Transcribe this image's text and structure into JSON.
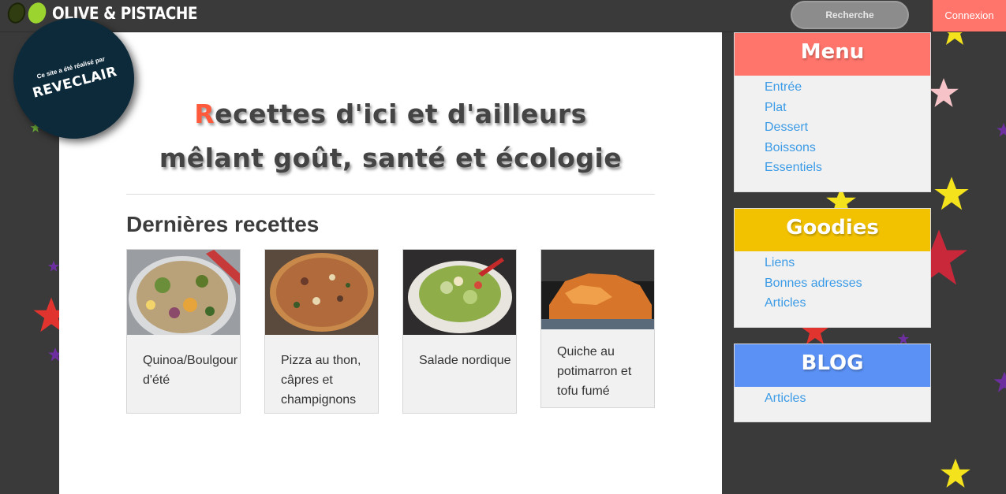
{
  "header": {
    "logo_text": "OLIVE & PISTACHE",
    "search_placeholder": "Recherche",
    "login_label": "Connexion"
  },
  "badge": {
    "line1": "Ce site a été réalisé par",
    "line2": "REVECLAIR"
  },
  "hero": {
    "first_letter": "R",
    "line1_rest": "ecettes d'ici et d'ailleurs",
    "line2": "mêlant goût, santé et écologie"
  },
  "latest": {
    "title": "Dernières recettes",
    "recipes": [
      {
        "title": "Quinoa/Boulgour d'été",
        "image": "quinoa-salad-photo"
      },
      {
        "title": "Pizza au thon, câpres et champignons",
        "image": "pizza-photo"
      },
      {
        "title": "Salade nordique",
        "image": "salad-photo"
      },
      {
        "title": "Quiche au potimarron et tofu fumé",
        "image": "quiche-photo"
      }
    ]
  },
  "sidebar": {
    "menu": {
      "title": "Menu",
      "color": "#ff756b",
      "items": [
        "Entrée",
        "Plat",
        "Dessert",
        "Boissons",
        "Essentiels"
      ]
    },
    "goodies": {
      "title": "Goodies",
      "color": "#f2c200",
      "items": [
        "Liens",
        "Bonnes adresses",
        "Articles"
      ]
    },
    "blog": {
      "title": "BLOG",
      "color": "#5b91f5",
      "items": [
        "Articles"
      ]
    }
  },
  "colors": {
    "accent": "#ff756b",
    "link": "#3b9be6",
    "background": "#3a3a3a"
  }
}
